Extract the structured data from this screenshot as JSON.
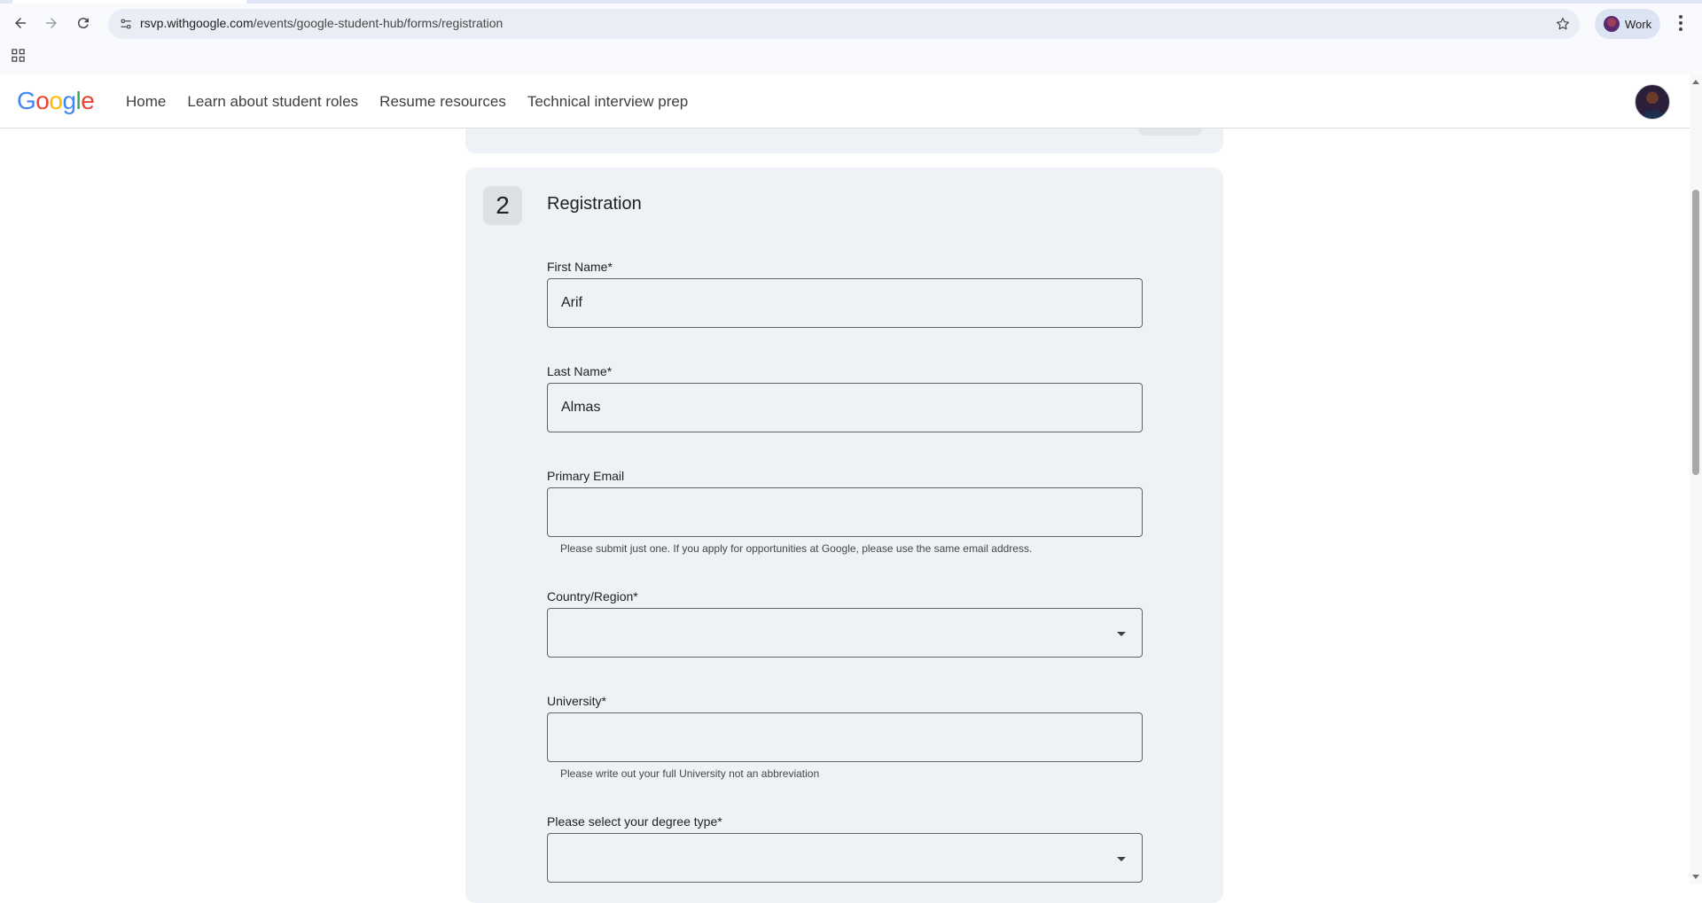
{
  "browser": {
    "url_host": "rsvp.withgoogle.com",
    "url_path": "/events/google-student-hub/forms/registration",
    "profile_label": "Work"
  },
  "site": {
    "logo_letters": [
      {
        "ch": "G",
        "color": "#4285F4"
      },
      {
        "ch": "o",
        "color": "#EA4335"
      },
      {
        "ch": "o",
        "color": "#FBBC05"
      },
      {
        "ch": "g",
        "color": "#4285F4"
      },
      {
        "ch": "l",
        "color": "#34A853"
      },
      {
        "ch": "e",
        "color": "#EA4335"
      }
    ],
    "nav": [
      "Home",
      "Learn about student roles",
      "Resume resources",
      "Technical interview prep"
    ]
  },
  "form": {
    "step_number": "2",
    "title": "Registration",
    "first_name": {
      "label": "First Name*",
      "value": "Arif"
    },
    "last_name": {
      "label": "Last Name*",
      "value": "Almas"
    },
    "primary_email": {
      "label": "Primary Email",
      "value": "",
      "hint": "Please submit just one. If you apply for opportunities at Google, please use the same email address."
    },
    "country": {
      "label": "Country/Region*",
      "value": ""
    },
    "university": {
      "label": "University*",
      "value": "",
      "hint": "Please write out your full University not an abbreviation"
    },
    "degree": {
      "label": "Please select your degree type*",
      "value": ""
    }
  }
}
